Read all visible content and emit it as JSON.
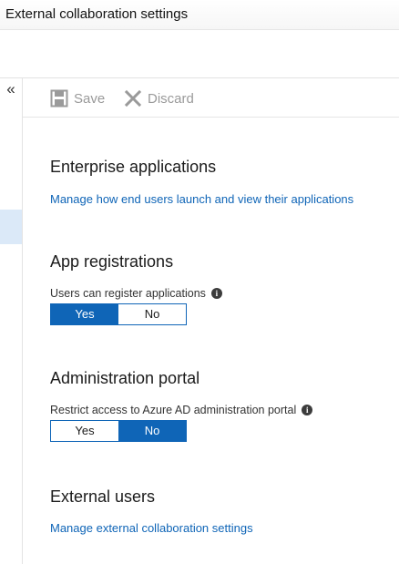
{
  "window": {
    "title": "External collaboration settings"
  },
  "nav": {
    "collapse_glyph": "«"
  },
  "toolbar": {
    "save_label": "Save",
    "discard_label": "Discard",
    "save_icon": "save-icon",
    "discard_icon": "x-icon"
  },
  "sections": {
    "enterprise": {
      "heading": "Enterprise applications",
      "link": "Manage how end users launch and view their applications"
    },
    "app_registrations": {
      "heading": "App registrations",
      "label": "Users can register applications",
      "yes": "Yes",
      "no": "No",
      "selected": "Yes"
    },
    "admin_portal": {
      "heading": "Administration portal",
      "label": "Restrict access to Azure AD administration portal",
      "yes": "Yes",
      "no": "No",
      "selected": "No"
    },
    "external_users": {
      "heading": "External users",
      "link": "Manage external collaboration settings"
    }
  },
  "colors": {
    "accent": "#0f65b7",
    "link": "#0f65b7",
    "disabled": "#9a9a9a"
  }
}
